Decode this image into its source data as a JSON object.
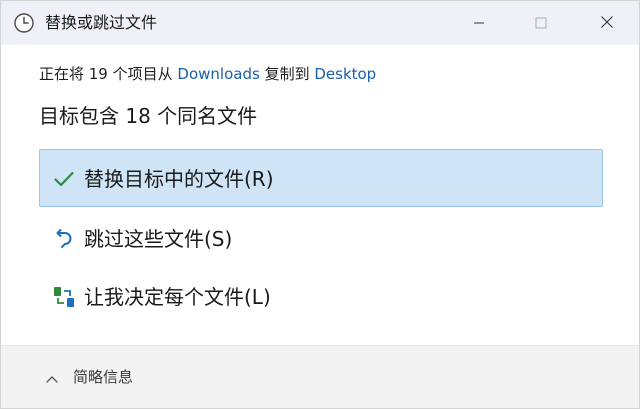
{
  "window": {
    "title": "替换或跳过文件",
    "icon": "clock-icon",
    "controls": {
      "minimize": "minimize-icon",
      "maximize": "maximize-icon",
      "close": "close-icon"
    }
  },
  "summary": {
    "prefix": "正在将 19 个项目从 ",
    "source": "Downloads",
    "middle": " 复制到 ",
    "destination": "Desktop"
  },
  "heading": "目标包含 18 个同名文件",
  "options": [
    {
      "label": "替换目标中的文件(R)",
      "icon": "checkmark-icon",
      "color": "#2e8b3a",
      "selected": true
    },
    {
      "label": "跳过这些文件(S)",
      "icon": "skip-arrow-icon",
      "color": "#1b6fc2",
      "selected": false
    },
    {
      "label": "让我决定每个文件(L)",
      "icon": "compare-files-icon",
      "color": "#2e8b3a",
      "selected": false
    }
  ],
  "footer": {
    "label": "简略信息",
    "icon": "chevron-up-icon"
  },
  "colors": {
    "titlebar": "#eef2f8",
    "selected_bg": "#cfe5f7",
    "selected_border": "#98c7ea",
    "link": "#1b5fa8"
  }
}
